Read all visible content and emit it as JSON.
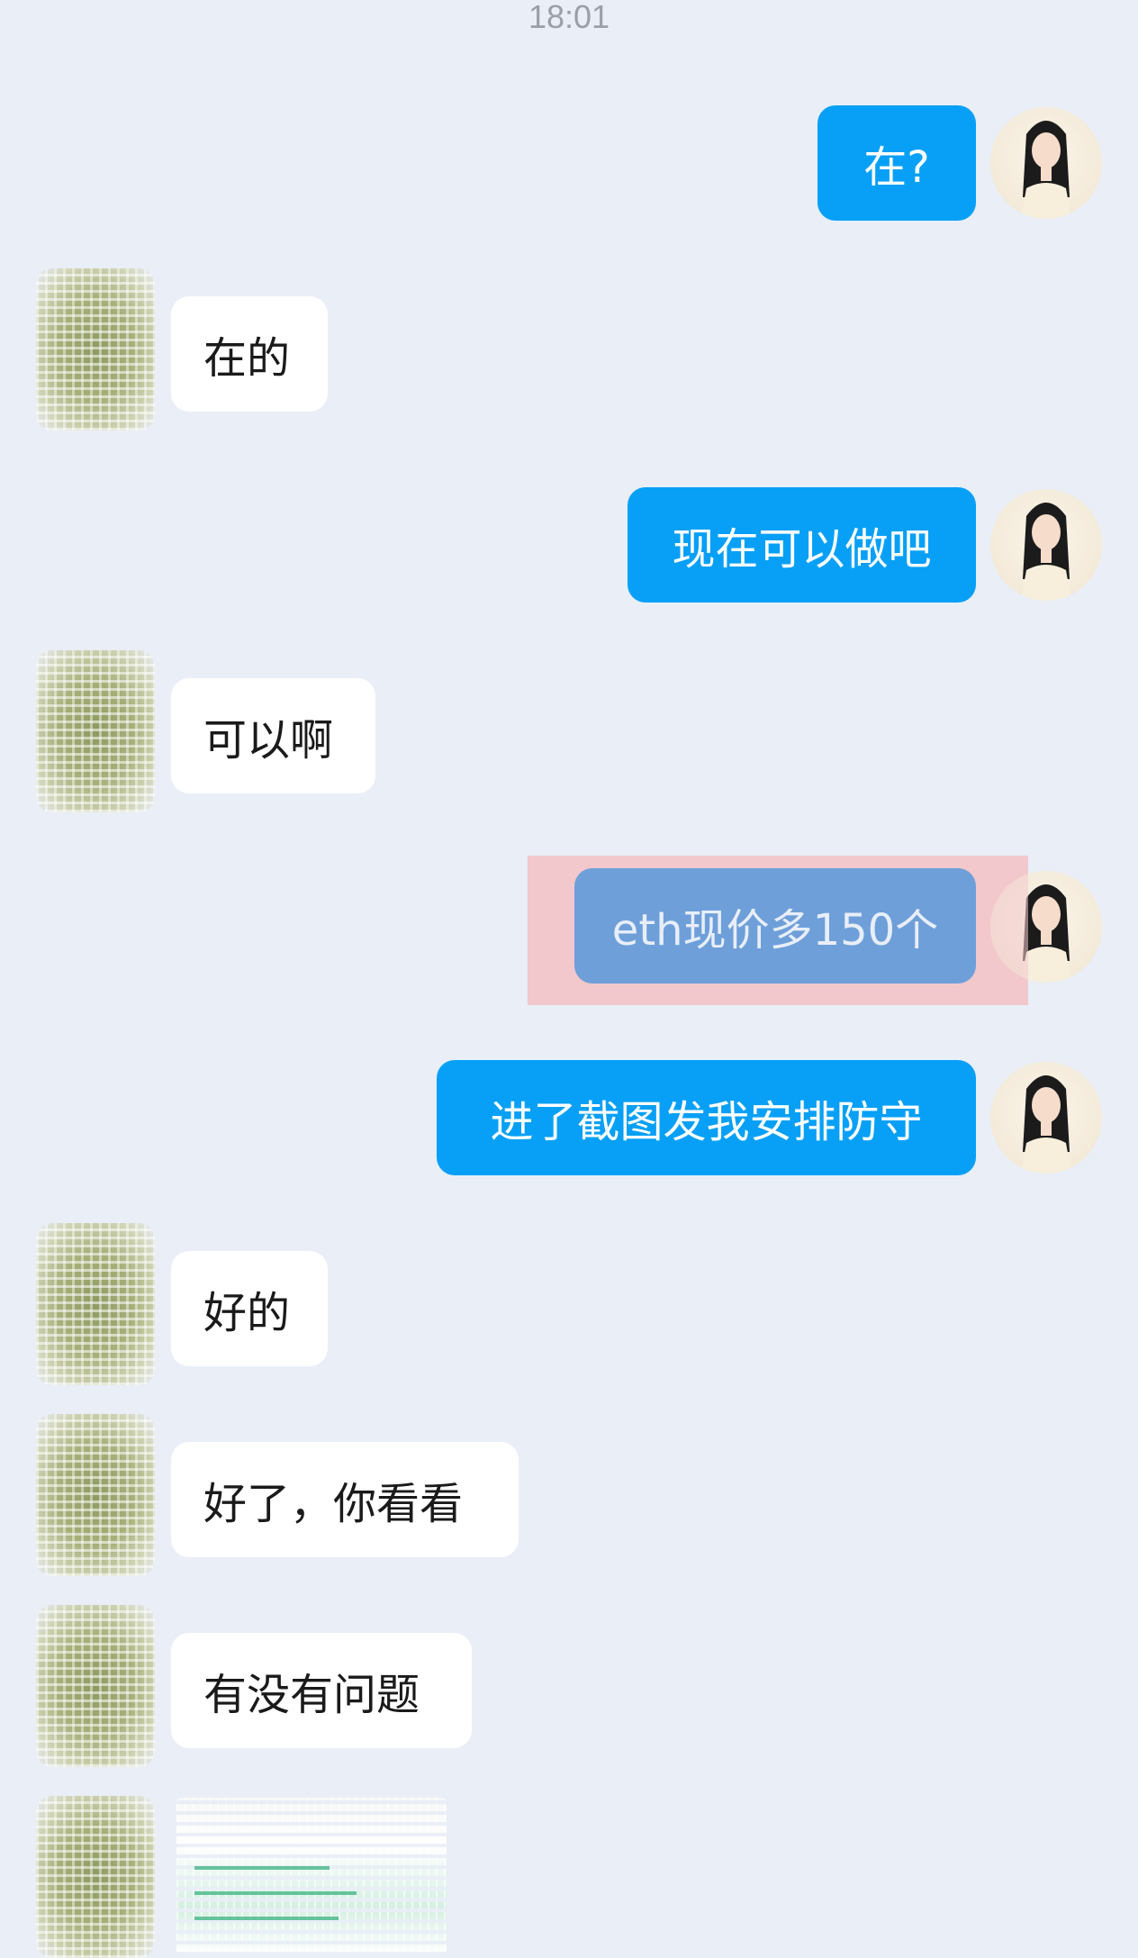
{
  "status": {
    "time": "18:01"
  },
  "messages": [
    {
      "direction": "outgoing",
      "text": "在?"
    },
    {
      "direction": "incoming",
      "text": "在的"
    },
    {
      "direction": "outgoing",
      "text": "现在可以做吧"
    },
    {
      "direction": "incoming",
      "text": "可以啊"
    },
    {
      "direction": "outgoing",
      "text": "eth现价多150个",
      "selected": true
    },
    {
      "direction": "outgoing",
      "text": "进了截图发我安排防守"
    },
    {
      "direction": "incoming",
      "text": "好的"
    },
    {
      "direction": "incoming",
      "text": "好了，你看看"
    },
    {
      "direction": "incoming",
      "text": "有没有问题"
    },
    {
      "direction": "incoming",
      "type": "image"
    }
  ],
  "colors": {
    "background": "#e9eef7",
    "outgoing_bubble": "#07a0f6",
    "incoming_bubble": "#ffffff",
    "selection_highlight": "#f2c8cc",
    "selected_bubble": "#6e9fd9"
  },
  "icons": {
    "my_avatar": "female-portrait-avatar",
    "contact_avatar": "cactus-avatar"
  }
}
